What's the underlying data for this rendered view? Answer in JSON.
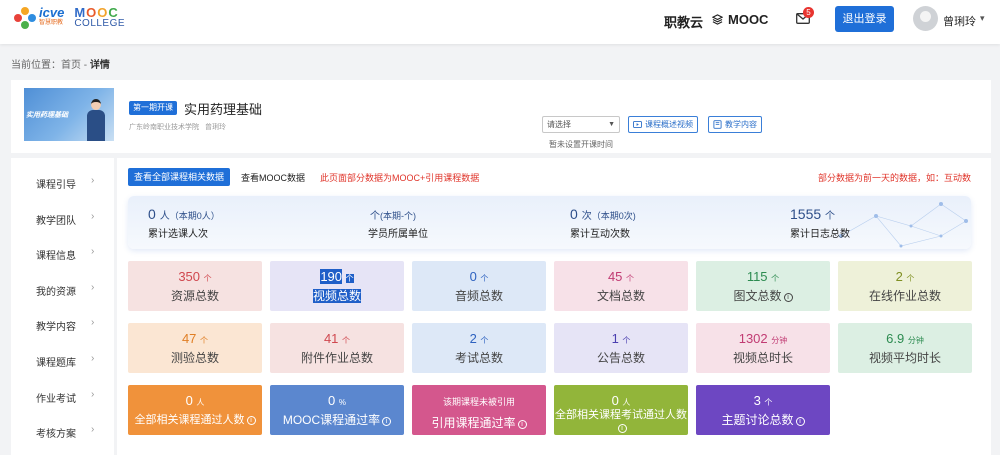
{
  "header": {
    "logo_icve": "icve",
    "logo_icve_sub": "智慧职教",
    "logo_mooc": "MOOC",
    "logo_college": "COLLEGE",
    "nav_zjy": "职教云",
    "nav_mooc": "MOOC",
    "mail_count": "5",
    "logout": "退出登录",
    "username": "曾琍玲"
  },
  "breadcrumb": {
    "prefix": "当前位置：",
    "home": "首页",
    "sep": " - ",
    "current": "详情"
  },
  "course": {
    "thumb_title": "实用药理基础",
    "term_badge": "第一期开课",
    "title": "实用药理基础",
    "school": "广东岭南职业技术学院",
    "teacher": "曾琍玲",
    "select_placeholder": "请选择",
    "no_time": "暂未设置开课时间",
    "btn_video": "课程概述视频",
    "btn_content": "教学内容"
  },
  "sidebar": {
    "items": [
      {
        "label": "课程引导"
      },
      {
        "label": "教学团队"
      },
      {
        "label": "课程信息"
      },
      {
        "label": "我的资源"
      },
      {
        "label": "教学内容"
      },
      {
        "label": "课程题库"
      },
      {
        "label": "作业考试"
      },
      {
        "label": "考核方案"
      }
    ]
  },
  "main": {
    "btn_all": "查看全部课程相关数据",
    "tab_mooc": "查看MOOC数据",
    "note_left": "此页面部分数据为MOOC+引用课程数据",
    "note_right": "部分数据为前一天的数据，如：互动数"
  },
  "summary": [
    {
      "value": "0",
      "unit": "人",
      "sub": "（本期0人）",
      "label": "累计选课人次"
    },
    {
      "value": "",
      "unit": "个",
      "sub": "(本期-个)",
      "label": "学员所属单位"
    },
    {
      "value": "0",
      "unit": "次",
      "sub": "（本期0次)",
      "label": "累计互动次数"
    },
    {
      "value": "1555",
      "unit": "个",
      "sub": "",
      "label": "累计日志总数"
    }
  ],
  "tiles_row1": [
    {
      "value": "350",
      "unit": "个",
      "label": "资源总数",
      "bg": "#f6e2e1",
      "color": "#d0484f"
    },
    {
      "value": "190",
      "unit": "个",
      "label": "视频总数",
      "bg": "#e6e4f6",
      "color": "#4b3fb0"
    },
    {
      "value": "0",
      "unit": "个",
      "label": "音频总数",
      "bg": "#dde8f7",
      "color": "#2e62c0"
    },
    {
      "value": "45",
      "unit": "个",
      "label": "文档总数",
      "bg": "#f7e1e8",
      "color": "#c13b73"
    },
    {
      "value": "115",
      "unit": "个",
      "label": "图文总数",
      "bg": "#dcefe3",
      "color": "#2c8b50"
    },
    {
      "value": "2",
      "unit": "个",
      "label": "在线作业总数",
      "bg": "#eef1d9",
      "color": "#7f8f22"
    }
  ],
  "tiles_row2": [
    {
      "value": "47",
      "unit": "个",
      "label": "测验总数",
      "bg": "#fbe6d3",
      "color": "#e07e24"
    },
    {
      "value": "41",
      "unit": "个",
      "label": "附件作业总数",
      "bg": "#f6e2e1",
      "color": "#d0484f"
    },
    {
      "value": "2",
      "unit": "个",
      "label": "考试总数",
      "bg": "#dde8f7",
      "color": "#2e62c0"
    },
    {
      "value": "1",
      "unit": "个",
      "label": "公告总数",
      "bg": "#e6e4f6",
      "color": "#4b3fb0"
    },
    {
      "value": "1302",
      "unit": "分钟",
      "label": "视频总时长",
      "bg": "#f7e1e8",
      "color": "#c13b73"
    },
    {
      "value": "6.9",
      "unit": "分钟",
      "label": "视频平均时长",
      "bg": "#dcefe3",
      "color": "#2c8b50"
    }
  ],
  "tiles_row3": [
    {
      "value": "0",
      "unit": "人",
      "label": "全部相关课程通过人数",
      "bg": "#f0923b"
    },
    {
      "value": "0",
      "unit": "%",
      "label": "MOOC课程通过率",
      "bg": "#5b87cf"
    },
    {
      "value": "该期课程未被引用",
      "unit": "",
      "label": "引用课程通过率",
      "bg": "#d4578d"
    },
    {
      "value": "0",
      "unit": "人",
      "label": "全部相关课程考试通过人数",
      "bg": "#92b53a"
    },
    {
      "value": "3",
      "unit": "个",
      "label": "主题讨论总数",
      "bg": "#6d47c2"
    }
  ]
}
